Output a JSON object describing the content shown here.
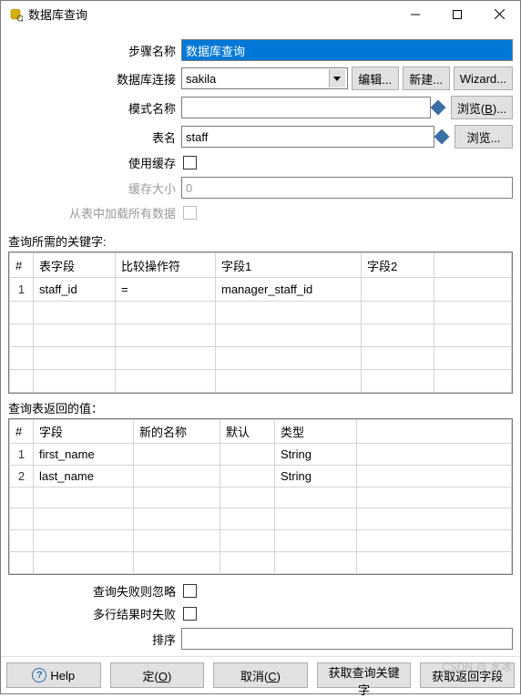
{
  "window": {
    "title": "数据库查询"
  },
  "form": {
    "step_name_label": "步骤名称",
    "step_name_value": "数据库查询",
    "db_conn_label": "数据库连接",
    "db_conn_value": "sakila",
    "edit_btn": "编辑...",
    "new_btn": "新建...",
    "wizard_btn": "Wizard...",
    "schema_label": "模式名称",
    "schema_value": "",
    "browse_b_btn": "浏览(B)...",
    "table_label": "表名",
    "table_value": "staff",
    "browse_btn": "浏览...",
    "use_cache_label": "使用缓存",
    "cache_size_label": "缓存大小",
    "cache_size_value": "0",
    "load_all_label": "从表中加载所有数据"
  },
  "keys": {
    "section_label": "查询所需的关键字:",
    "headers": {
      "num": "#",
      "field": "表字段",
      "op": "比较操作符",
      "f1": "字段1",
      "f2": "字段2"
    },
    "rows": [
      {
        "num": "1",
        "field": "staff_id",
        "op": "=",
        "f1": "manager_staff_id",
        "f2": ""
      }
    ]
  },
  "returns": {
    "section_label": "查询表返回的值：",
    "headers": {
      "num": "#",
      "field": "字段",
      "newname": "新的名称",
      "default": "默认",
      "type": "类型"
    },
    "rows": [
      {
        "num": "1",
        "field": "first_name",
        "newname": "",
        "default": "",
        "type": "String"
      },
      {
        "num": "2",
        "field": "last_name",
        "newname": "",
        "default": "",
        "type": "String"
      }
    ]
  },
  "bottom_form": {
    "ignore_fail_label": "查询失败则忽略",
    "fail_multi_label": "多行结果时失败",
    "sort_label": "排序",
    "sort_value": ""
  },
  "buttons": {
    "help": "Help",
    "ok_html": "定(O)",
    "cancel": "取消(C)",
    "get_keys": "获取查询关键字",
    "get_returns": "获取返回字段"
  },
  "watermark": "CSDN @ 水冰"
}
